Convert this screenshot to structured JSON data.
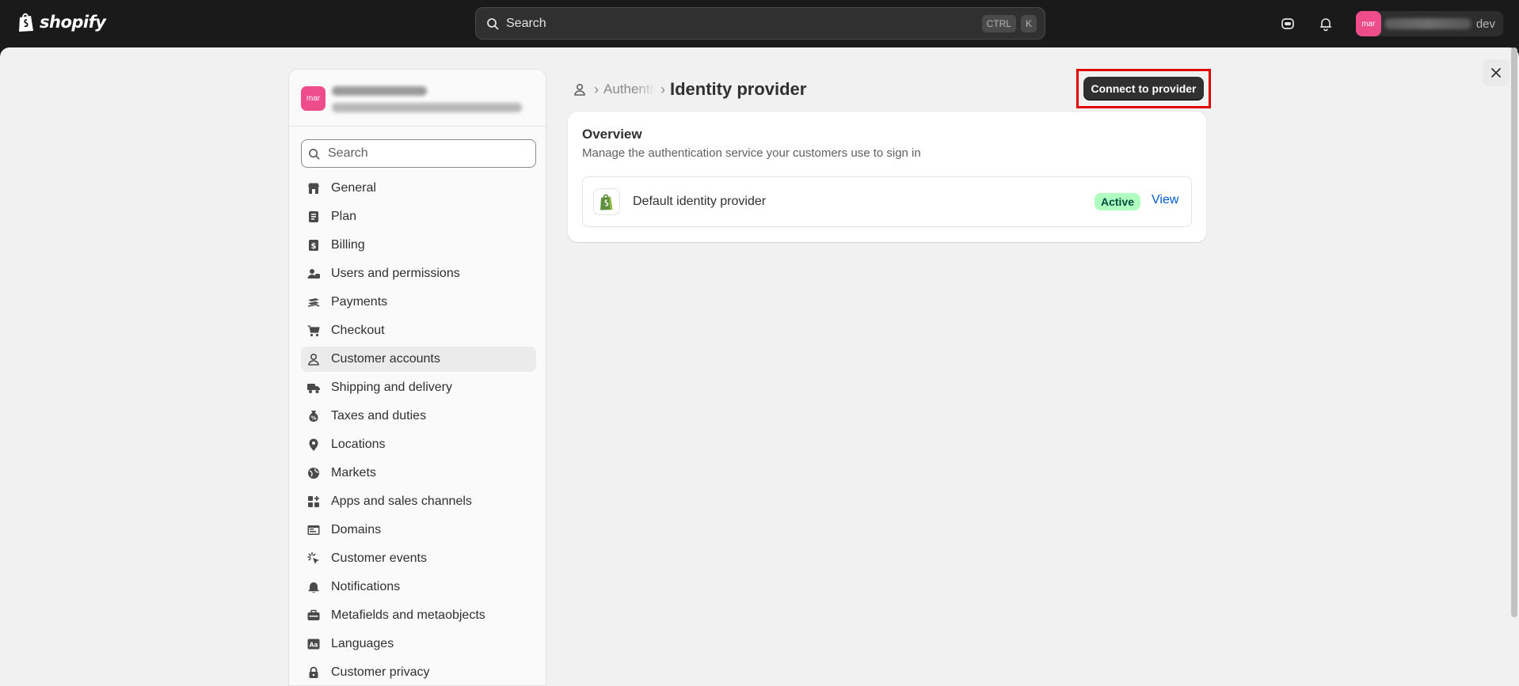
{
  "app": {
    "brand": "shopify",
    "colors": {
      "topbar": "#1a1a1a",
      "accent": "#005bd3",
      "badge_bg": "#affebf",
      "avatar": "#ef4c8c",
      "highlight": "#e00000"
    }
  },
  "topbar": {
    "search_label": "Search",
    "shortcut_keys": [
      "CTRL",
      "K"
    ],
    "icons": [
      "sidekick-icon",
      "bell-icon"
    ],
    "user": {
      "avatar_initials": "mar",
      "store_tag": "dev"
    }
  },
  "sidebar": {
    "store": {
      "avatar_initials": "mar"
    },
    "search_placeholder": "Search",
    "items": [
      {
        "label": "General",
        "icon": "store-icon"
      },
      {
        "label": "Plan",
        "icon": "plan-icon"
      },
      {
        "label": "Billing",
        "icon": "billing-icon"
      },
      {
        "label": "Users and permissions",
        "icon": "users-icon"
      },
      {
        "label": "Payments",
        "icon": "payments-icon"
      },
      {
        "label": "Checkout",
        "icon": "cart-icon"
      },
      {
        "label": "Customer accounts",
        "icon": "person-icon",
        "active": true
      },
      {
        "label": "Shipping and delivery",
        "icon": "truck-icon"
      },
      {
        "label": "Taxes and duties",
        "icon": "tax-icon"
      },
      {
        "label": "Locations",
        "icon": "location-icon"
      },
      {
        "label": "Markets",
        "icon": "globe-icon"
      },
      {
        "label": "Apps and sales channels",
        "icon": "apps-icon"
      },
      {
        "label": "Domains",
        "icon": "domains-icon"
      },
      {
        "label": "Customer events",
        "icon": "events-icon"
      },
      {
        "label": "Notifications",
        "icon": "bell-icon"
      },
      {
        "label": "Metafields and metaobjects",
        "icon": "metafields-icon"
      },
      {
        "label": "Languages",
        "icon": "language-icon"
      },
      {
        "label": "Customer privacy",
        "icon": "lock-icon"
      }
    ]
  },
  "breadcrumb": {
    "parent": "Authentication",
    "current": "Identity provider"
  },
  "header": {
    "primary_action": "Connect to provider"
  },
  "overview": {
    "title": "Overview",
    "description": "Manage the authentication service your customers use to sign in",
    "provider": {
      "name": "Default identity provider",
      "status": "Active",
      "action": "View"
    }
  }
}
